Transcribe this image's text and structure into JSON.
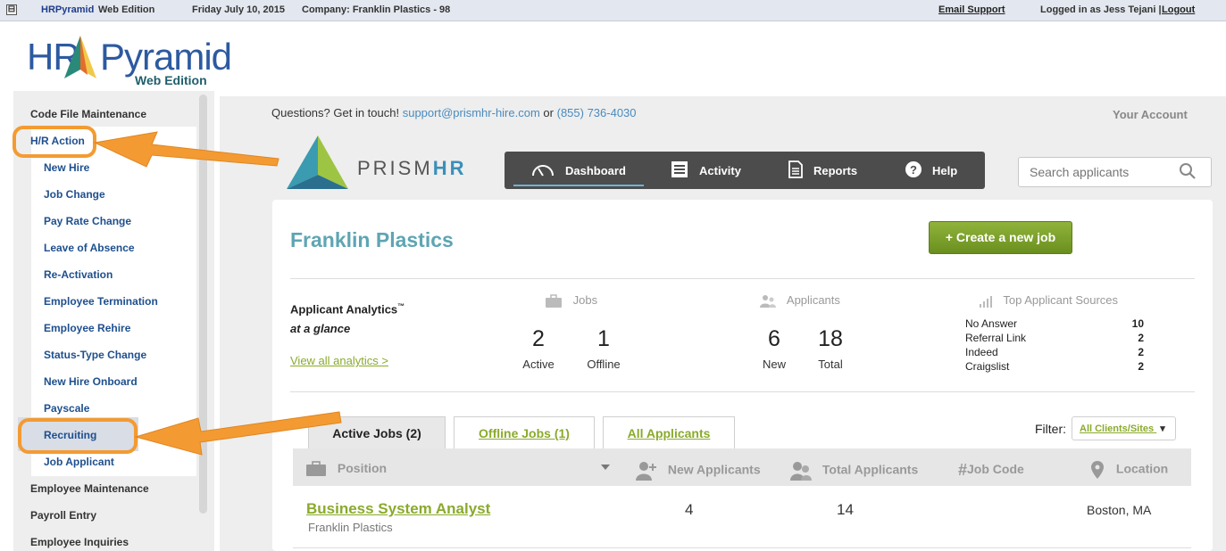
{
  "topbar": {
    "collapse_glyph": "⊟",
    "app_name": "HRPyramid",
    "edition": "Web Edition",
    "date": "Friday July 10, 2015",
    "company": "Company: Franklin Plastics - 98",
    "email_support": "Email Support",
    "logged_in": "Logged in as Jess Tejani |",
    "logout": "Logout"
  },
  "logo": {
    "hr": "HR",
    "pyramid": "Pyramid",
    "sub": "Web Edition"
  },
  "sidebar": {
    "items": [
      {
        "label": "Code File Maintenance",
        "level": "top"
      },
      {
        "label": "H/R Action",
        "level": "top"
      },
      {
        "label": "New Hire",
        "level": "sub"
      },
      {
        "label": "Job Change",
        "level": "sub"
      },
      {
        "label": "Pay Rate Change",
        "level": "sub"
      },
      {
        "label": "Leave of Absence",
        "level": "sub"
      },
      {
        "label": "Re-Activation",
        "level": "sub"
      },
      {
        "label": "Employee Termination",
        "level": "sub"
      },
      {
        "label": "Employee Rehire",
        "level": "sub"
      },
      {
        "label": "Status-Type Change",
        "level": "sub"
      },
      {
        "label": "New Hire Onboard",
        "level": "sub"
      },
      {
        "label": "Payscale",
        "level": "sub"
      },
      {
        "label": "Recruiting",
        "level": "sub",
        "selected": true
      },
      {
        "label": "Job Applicant",
        "level": "sub"
      },
      {
        "label": "Employee Maintenance",
        "level": "top"
      },
      {
        "label": "Payroll Entry",
        "level": "top"
      },
      {
        "label": "Employee Inquiries",
        "level": "top"
      }
    ]
  },
  "header": {
    "questions": "Questions? Get in touch!",
    "email": "support@prismhr-hire.com",
    "or": "or",
    "phone": "(855) 736-4030",
    "your_account": "Your Account",
    "prism": "PRISM",
    "hr": "HR"
  },
  "nav": {
    "items": [
      {
        "label": "Dashboard",
        "icon": "speedometer-icon"
      },
      {
        "label": "Activity",
        "icon": "list-icon"
      },
      {
        "label": "Reports",
        "icon": "document-icon"
      },
      {
        "label": "Help",
        "icon": "question-icon"
      }
    ]
  },
  "search": {
    "placeholder": "Search applicants"
  },
  "company_name": "Franklin Plastics",
  "create_job": "+ Create a new job",
  "analytics": {
    "title": "Applicant Analytics",
    "tm": "™",
    "subtitle": "at a glance",
    "link": "View all analytics >",
    "jobs_header": "Jobs",
    "jobs_active_value": "2",
    "jobs_active_label": "Active",
    "jobs_offline_value": "1",
    "jobs_offline_label": "Offline",
    "applicants_header": "Applicants",
    "applicants_new_value": "6",
    "applicants_new_label": "New",
    "applicants_total_value": "18",
    "applicants_total_label": "Total",
    "sources_header": "Top Applicant Sources",
    "sources": [
      {
        "name": "No Answer",
        "count": "10"
      },
      {
        "name": "Referral Link",
        "count": "2"
      },
      {
        "name": "Indeed",
        "count": "2"
      },
      {
        "name": "Craigslist",
        "count": "2"
      }
    ]
  },
  "tabs": {
    "active": "Active Jobs (2)",
    "offline": "Offline Jobs (1)",
    "all": "All Applicants"
  },
  "filter": {
    "label": "Filter:",
    "value": "All Clients/Sites"
  },
  "table": {
    "headers": {
      "position": "Position",
      "new_applicants": "New Applicants",
      "total_applicants": "Total Applicants",
      "job_code": "Job Code",
      "location": "Location"
    },
    "rows": [
      {
        "title": "Business System Analyst",
        "company": "Franklin Plastics",
        "new": "4",
        "total": "14",
        "code": "",
        "location": "Boston, MA"
      }
    ]
  },
  "colors": {
    "accent_green": "#8aaa2c",
    "highlight_orange": "#f39b32",
    "nav_bg": "#4c4c4c",
    "company_teal": "#5ea5b3"
  }
}
